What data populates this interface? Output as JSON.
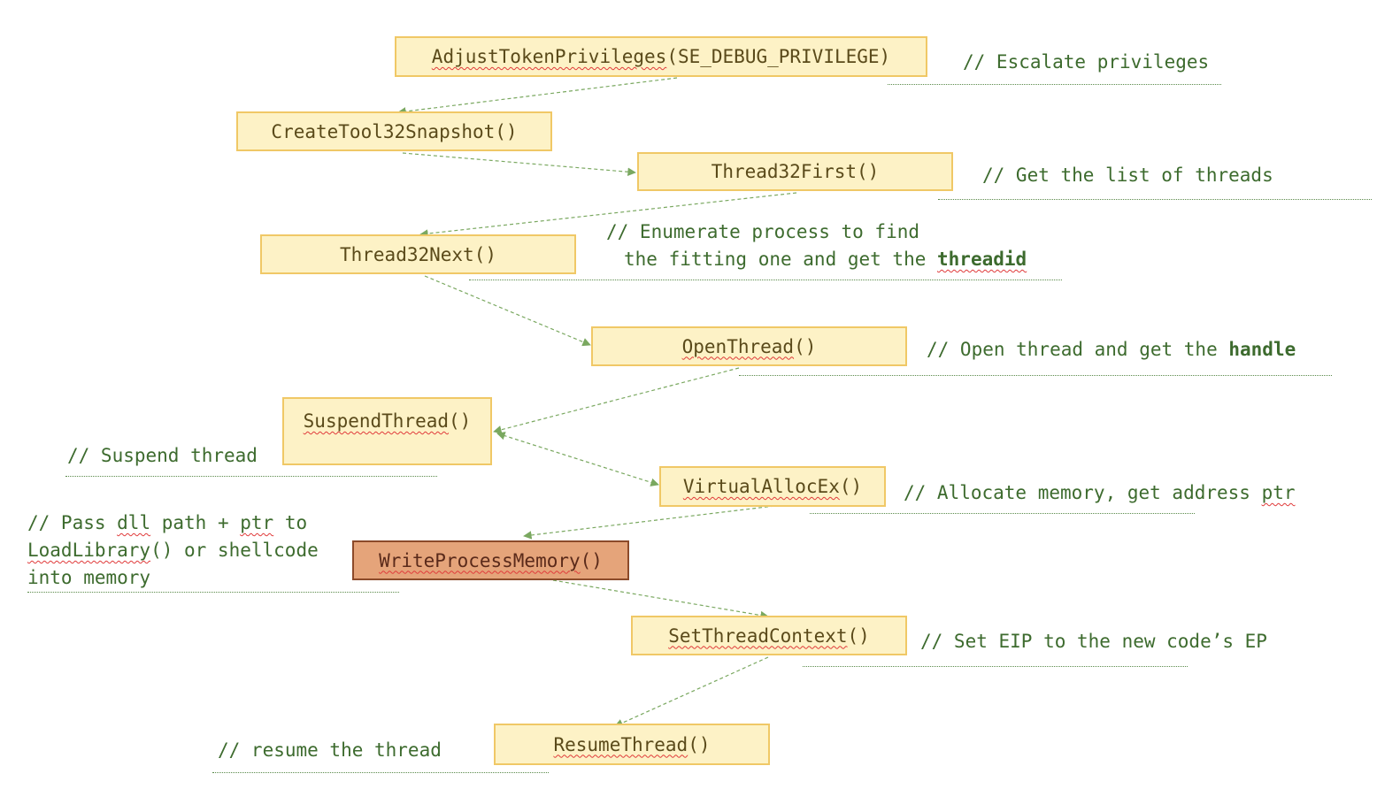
{
  "nodes": {
    "adjust": {
      "name": "AdjustTokenPrivileges",
      "arg": "(SE_DEBUG_PRIVILEGE)"
    },
    "snapshot": {
      "label": "CreateTool32Snapshot()"
    },
    "first": {
      "label": "Thread32First()"
    },
    "next": {
      "label": "Thread32Next()"
    },
    "open": {
      "name": "OpenThread",
      "parens": "()"
    },
    "suspend": {
      "name": "SuspendThread",
      "parens": "()"
    },
    "valloc": {
      "name": "VirtualAllocEx",
      "parens": "()"
    },
    "wpm": {
      "name": "WriteProcessMemory",
      "parens": "()"
    },
    "setctx": {
      "name": "SetThreadContext",
      "parens": "()"
    },
    "resume": {
      "name": "ResumeThread",
      "parens": "()"
    }
  },
  "comments": {
    "escalate": "// Escalate privileges",
    "list_threads": "// Get the list of threads",
    "enumerate_l1": "// Enumerate process to find",
    "enumerate_l2_pre": "the fitting one and get the ",
    "enumerate_l2_bold": "threadid",
    "open_pre": "// Open thread and get the ",
    "open_bold": "handle",
    "suspend": "// Suspend thread",
    "alloc_pre": "// Allocate memory, get address ",
    "alloc_ptr": "ptr",
    "pass_l1_a": "// Pass ",
    "pass_l1_dll": "dll",
    "pass_l1_b": " path + ",
    "pass_l1_ptr": "ptr",
    "pass_l1_c": " to",
    "pass_l2_fn": "LoadLibrary",
    "pass_l2_rest": "() or shellcode",
    "pass_l3": "into memory",
    "set_eip": "// Set EIP to the new code’s EP",
    "resume": "// resume the thread"
  },
  "colors": {
    "node_fill": "#fdf2c6",
    "node_border": "#f0c866",
    "highlight_fill": "#e5a47a",
    "highlight_border": "#8c4a2a",
    "comment_text": "#3d6b2e",
    "arrow": "#7aa860",
    "spell_squiggle": "#e03a3a"
  }
}
